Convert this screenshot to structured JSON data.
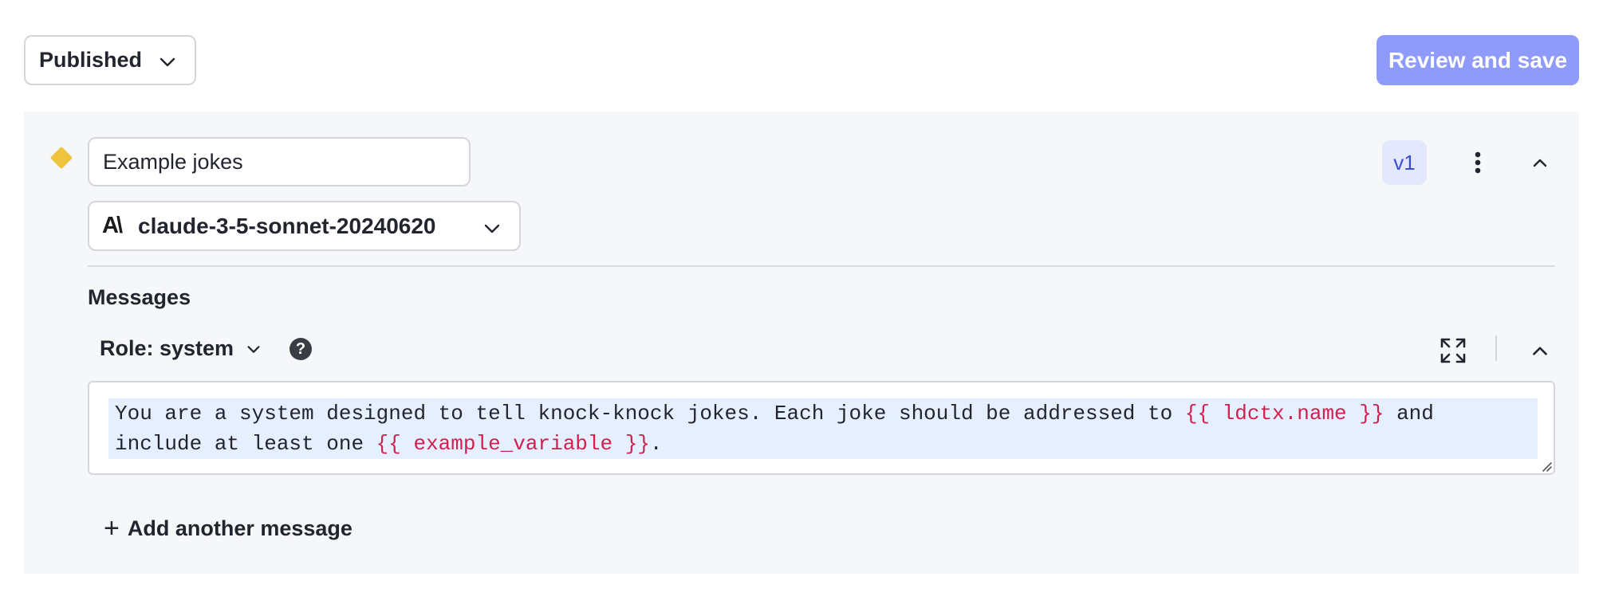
{
  "header": {
    "status": "Published",
    "review_button": "Review and save"
  },
  "variation": {
    "name": "Example jokes",
    "model_logo": "A\\",
    "model": "claude-3-5-sonnet-20240620",
    "version": "v1",
    "status_color": "#f0c33c"
  },
  "messages": {
    "title": "Messages",
    "items": [
      {
        "role_label": "Role: system",
        "text_parts": [
          "You are a system designed to tell knock-knock jokes. Each joke should be addressed to ",
          "{{ ldctx.name }}",
          " and include at least one ",
          "{{ example_variable }}",
          "."
        ]
      }
    ],
    "add_label": "Add another message"
  },
  "colors": {
    "accent": "#8f9bfa",
    "variable": "#d0214e",
    "badge_bg": "#e4e8fd",
    "badge_text": "#3a4ed8"
  },
  "icons": {
    "status_chevron": "chevron-down-icon",
    "model_logo": "anthropic-logo-icon",
    "more": "more-vertical-icon",
    "collapse": "chevron-up-icon",
    "help": "help-circle-icon",
    "expand": "expand-icon",
    "add": "plus-icon"
  }
}
